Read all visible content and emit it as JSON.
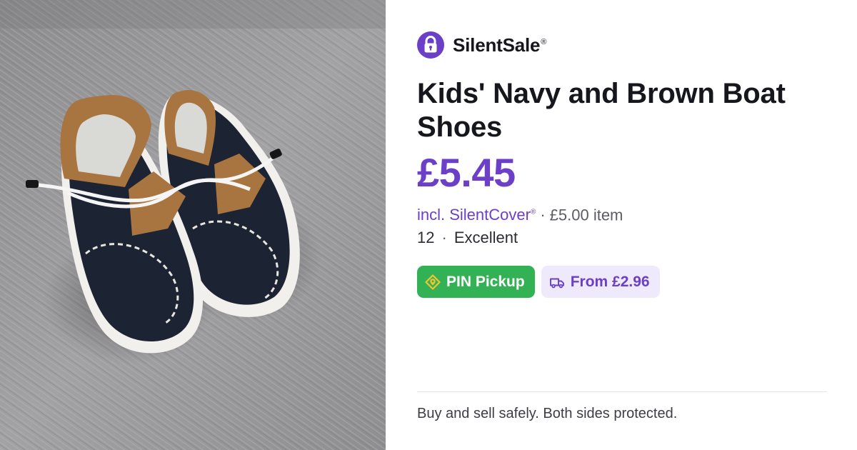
{
  "photo": {
    "alt": "Kids' Navy and Brown Boat Shoes"
  },
  "brand": {
    "name": "SilentSale",
    "registered": "®",
    "logo_icon": "padlock-shield-icon"
  },
  "listing": {
    "title": "Kids' Navy and Brown Boat Shoes",
    "price": "£5.45",
    "cover_label": "incl. SilentCover",
    "cover_registered": "®",
    "cover_separator": "·",
    "item_price": "£5.00 item",
    "size": "12",
    "meta_separator": "·",
    "condition": "Excellent"
  },
  "badges": {
    "pickup": {
      "label": "PIN Pickup",
      "icon": "location-tag-icon"
    },
    "shipping": {
      "label": "From £2.96",
      "icon": "delivery-truck-icon"
    }
  },
  "footer": {
    "tagline": "Buy and sell safely. Both sides protected."
  },
  "colors": {
    "brand_purple": "#6b3fc7",
    "pickup_green": "#32b155",
    "shipping_bg": "#efeafb",
    "carpet_gray": "#9a9a9c",
    "shoe_navy": "#1c2333",
    "shoe_tan": "#a8743f"
  }
}
